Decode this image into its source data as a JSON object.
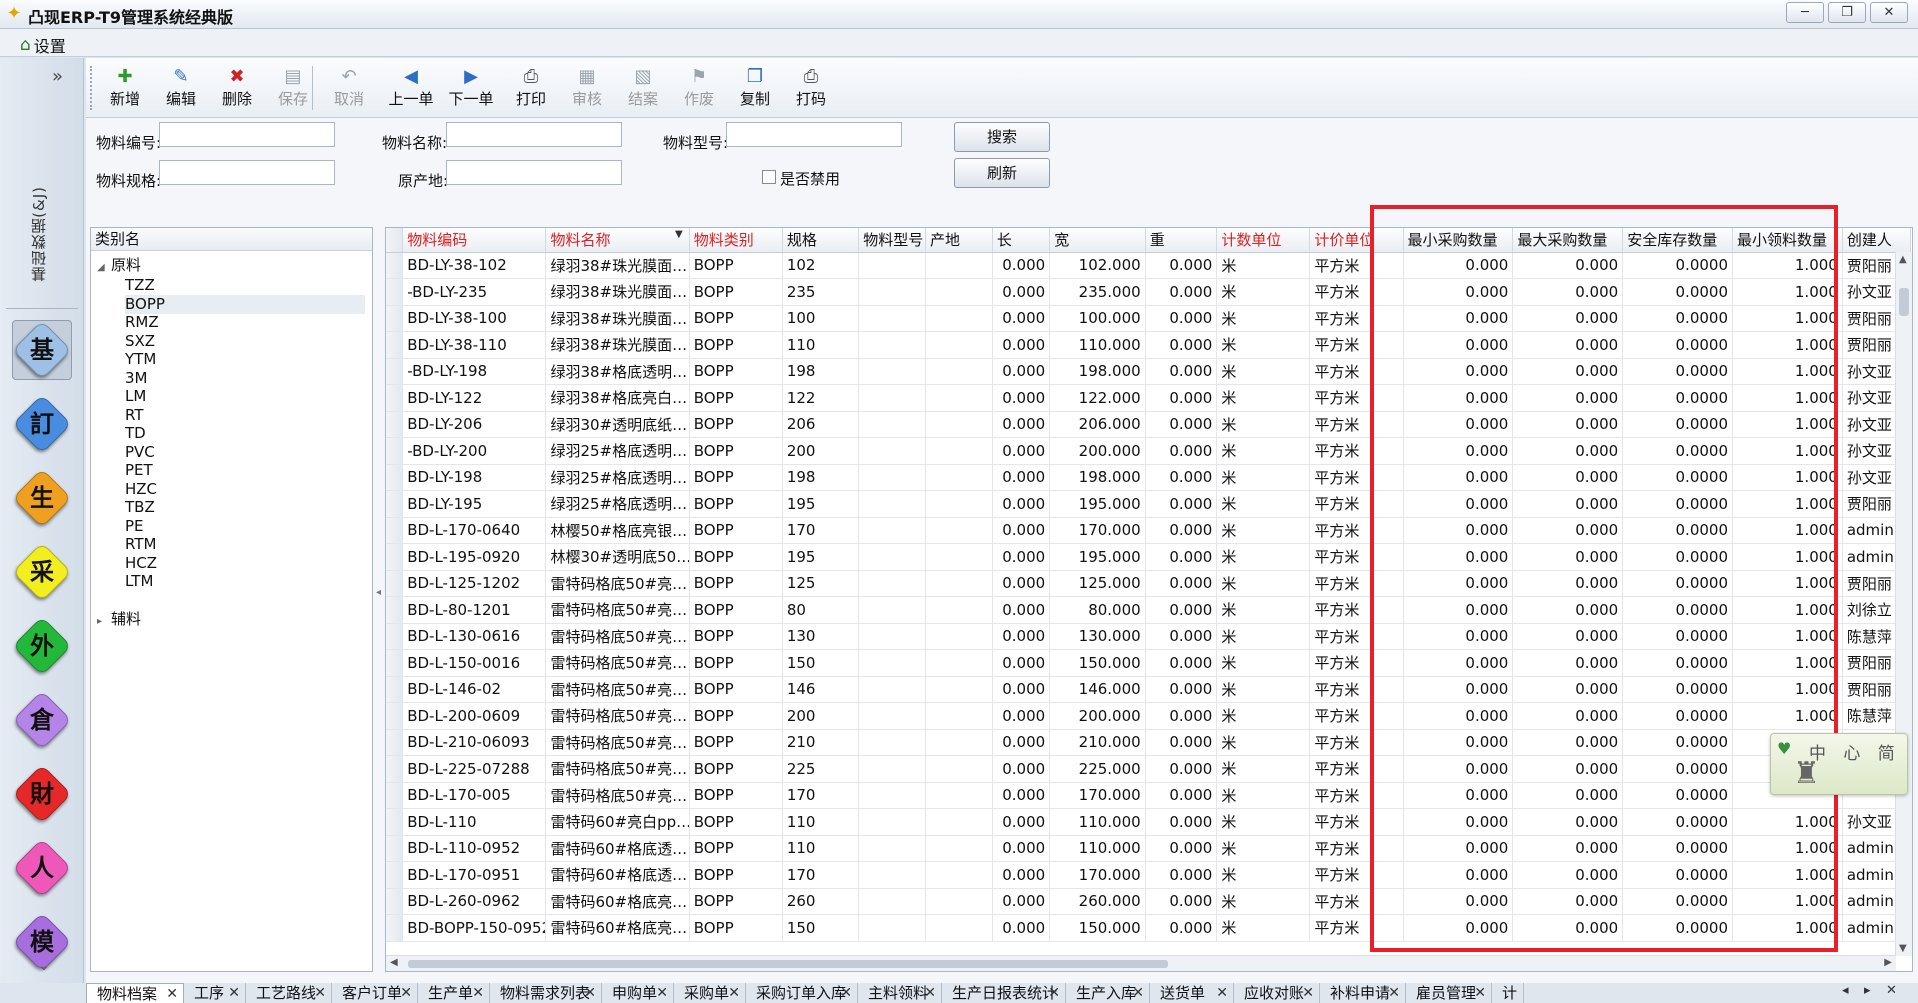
{
  "window": {
    "title": "凸现ERP-T9管理系统经典版",
    "icon": "star-logo-icon",
    "buttons": [
      "─",
      "❐",
      "✕"
    ]
  },
  "menu": {
    "settings": "设置"
  },
  "leftnav": {
    "collapse": "»",
    "section": "基础数据(&J)",
    "buttons": [
      {
        "glyph": "基",
        "color": "#9fc0e6",
        "name": "basic-data"
      },
      {
        "glyph": "訂",
        "color": "#4a8de0",
        "name": "orders"
      },
      {
        "glyph": "生",
        "color": "#f0a020",
        "name": "production"
      },
      {
        "glyph": "采",
        "color": "#f2ee20",
        "name": "purchase"
      },
      {
        "glyph": "外",
        "color": "#24b83a",
        "name": "outsourcing"
      },
      {
        "glyph": "倉",
        "color": "#b484e8",
        "name": "warehouse"
      },
      {
        "glyph": "財",
        "color": "#e62828",
        "name": "finance"
      },
      {
        "glyph": "人",
        "color": "#ee58b8",
        "name": "personnel"
      },
      {
        "glyph": "模",
        "color": "#a86ee0",
        "name": "molds"
      }
    ],
    "down": "⌄"
  },
  "toolbar": {
    "buttons": [
      {
        "label": "新增",
        "icon": "✚",
        "color": "#2e9a2e",
        "enabled": true,
        "name": "add"
      },
      {
        "label": "编辑",
        "icon": "✎",
        "color": "#2e6fc4",
        "enabled": true,
        "name": "edit"
      },
      {
        "label": "删除",
        "icon": "✖",
        "color": "#d42020",
        "enabled": true,
        "name": "delete"
      },
      {
        "label": "保存",
        "icon": "▤",
        "color": "#9aa4ad",
        "enabled": false,
        "name": "save"
      },
      {
        "label": "取消",
        "icon": "↶",
        "color": "#9aa4ad",
        "enabled": false,
        "name": "cancel"
      },
      {
        "label": "上一单",
        "icon": "◀",
        "color": "#2e6fc4",
        "enabled": true,
        "name": "prev"
      },
      {
        "label": "下一单",
        "icon": "▶",
        "color": "#2e6fc4",
        "enabled": true,
        "name": "next"
      },
      {
        "label": "打印",
        "icon": "⎙",
        "color": "#555",
        "enabled": true,
        "name": "print"
      },
      {
        "label": "审核",
        "icon": "▦",
        "color": "#9aa4ad",
        "enabled": false,
        "name": "audit"
      },
      {
        "label": "结案",
        "icon": "▧",
        "color": "#9aa4ad",
        "enabled": false,
        "name": "close-case"
      },
      {
        "label": "作废",
        "icon": "⚑",
        "color": "#9aa4ad",
        "enabled": false,
        "name": "void"
      },
      {
        "label": "复制",
        "icon": "❐",
        "color": "#2e6fc4",
        "enabled": true,
        "name": "copy"
      },
      {
        "label": "打码",
        "icon": "⎙",
        "color": "#555",
        "enabled": true,
        "name": "barcode"
      }
    ]
  },
  "search": {
    "material_code": {
      "label": "物料编号:",
      "value": ""
    },
    "material_name": {
      "label": "物料名称:",
      "value": ""
    },
    "material_model": {
      "label": "物料型号:",
      "value": ""
    },
    "material_spec": {
      "label": "物料规格:",
      "value": ""
    },
    "origin": {
      "label": "原产地:",
      "value": ""
    },
    "disabled": {
      "label": "是否禁用",
      "checked": false
    },
    "search_btn": "搜索",
    "refresh_btn": "刷新"
  },
  "tree": {
    "header": "类别名",
    "root1": "原料",
    "root2": "辅料",
    "selected": "BOPP",
    "children": [
      "TZZ",
      "BOPP",
      "RMZ",
      "SXZ",
      "YTM",
      "3M",
      "LM",
      "RT",
      "TD",
      "PVC",
      "PET",
      "HZC",
      "TBZ",
      "PE",
      "RTM",
      "HCZ",
      "LTM"
    ],
    "collapse_arrow": "◂"
  },
  "grid": {
    "columns": [
      {
        "label": "物料编码",
        "red": true
      },
      {
        "label": "物料名称",
        "red": true,
        "sort": "▼"
      },
      {
        "label": "物料类别",
        "red": true
      },
      {
        "label": "规格"
      },
      {
        "label": "物料型号"
      },
      {
        "label": "产地"
      },
      {
        "label": "长"
      },
      {
        "label": "宽"
      },
      {
        "label": "重"
      },
      {
        "label": "计数单位",
        "red": true
      },
      {
        "label": "计价单位",
        "red": true
      },
      {
        "label": "最小采购数量"
      },
      {
        "label": "最大采购数量"
      },
      {
        "label": "安全库存数量"
      },
      {
        "label": "最小领料数量"
      },
      {
        "label": "创建人"
      }
    ],
    "rows": [
      [
        "BD-LY-38-102",
        "绿羽38#珠光膜面…",
        "BOPP",
        "102",
        "",
        "",
        "0.000",
        "102.000",
        "0.000",
        "米",
        "平方米",
        "0.000",
        "0.000",
        "0.0000",
        "1.000",
        "贾阳丽"
      ],
      [
        "-BD-LY-235",
        "绿羽38#珠光膜面…",
        "BOPP",
        "235",
        "",
        "",
        "0.000",
        "235.000",
        "0.000",
        "米",
        "平方米",
        "0.000",
        "0.000",
        "0.0000",
        "1.000",
        "孙文亚"
      ],
      [
        "BD-LY-38-100",
        "绿羽38#珠光膜面…",
        "BOPP",
        "100",
        "",
        "",
        "0.000",
        "100.000",
        "0.000",
        "米",
        "平方米",
        "0.000",
        "0.000",
        "0.0000",
        "1.000",
        "贾阳丽"
      ],
      [
        "BD-LY-38-110",
        "绿羽38#珠光膜面…",
        "BOPP",
        "110",
        "",
        "",
        "0.000",
        "110.000",
        "0.000",
        "米",
        "平方米",
        "0.000",
        "0.000",
        "0.0000",
        "1.000",
        "贾阳丽"
      ],
      [
        "-BD-LY-198",
        "绿羽38#格底透明…",
        "BOPP",
        "198",
        "",
        "",
        "0.000",
        "198.000",
        "0.000",
        "米",
        "平方米",
        "0.000",
        "0.000",
        "0.0000",
        "1.000",
        "孙文亚"
      ],
      [
        "BD-LY-122",
        "绿羽38#格底亮白…",
        "BOPP",
        "122",
        "",
        "",
        "0.000",
        "122.000",
        "0.000",
        "米",
        "平方米",
        "0.000",
        "0.000",
        "0.0000",
        "1.000",
        "孙文亚"
      ],
      [
        "BD-LY-206",
        "绿羽30#透明底纸…",
        "BOPP",
        "206",
        "",
        "",
        "0.000",
        "206.000",
        "0.000",
        "米",
        "平方米",
        "0.000",
        "0.000",
        "0.0000",
        "1.000",
        "孙文亚"
      ],
      [
        "-BD-LY-200",
        "绿羽25#格底透明…",
        "BOPP",
        "200",
        "",
        "",
        "0.000",
        "200.000",
        "0.000",
        "米",
        "平方米",
        "0.000",
        "0.000",
        "0.0000",
        "1.000",
        "孙文亚"
      ],
      [
        "BD-LY-198",
        "绿羽25#格底透明…",
        "BOPP",
        "198",
        "",
        "",
        "0.000",
        "198.000",
        "0.000",
        "米",
        "平方米",
        "0.000",
        "0.000",
        "0.0000",
        "1.000",
        "孙文亚"
      ],
      [
        "BD-LY-195",
        "绿羽25#格底透明…",
        "BOPP",
        "195",
        "",
        "",
        "0.000",
        "195.000",
        "0.000",
        "米",
        "平方米",
        "0.000",
        "0.000",
        "0.0000",
        "1.000",
        "贾阳丽"
      ],
      [
        "BD-L-170-0640",
        "林樱50#格底亮银…",
        "BOPP",
        "170",
        "",
        "",
        "0.000",
        "170.000",
        "0.000",
        "米",
        "平方米",
        "0.000",
        "0.000",
        "0.0000",
        "1.000",
        "admin"
      ],
      [
        "BD-L-195-0920",
        "林樱30#透明底50…",
        "BOPP",
        "195",
        "",
        "",
        "0.000",
        "195.000",
        "0.000",
        "米",
        "平方米",
        "0.000",
        "0.000",
        "0.0000",
        "1.000",
        "admin"
      ],
      [
        "BD-L-125-1202",
        "雷特码格底50#亮…",
        "BOPP",
        "125",
        "",
        "",
        "0.000",
        "125.000",
        "0.000",
        "米",
        "平方米",
        "0.000",
        "0.000",
        "0.0000",
        "1.000",
        "贾阳丽"
      ],
      [
        "BD-L-80-1201",
        "雷特码格底50#亮…",
        "BOPP",
        "80",
        "",
        "",
        "0.000",
        "80.000",
        "0.000",
        "米",
        "平方米",
        "0.000",
        "0.000",
        "0.0000",
        "1.000",
        "刘徐立"
      ],
      [
        "BD-L-130-0616",
        "雷特码格底50#亮…",
        "BOPP",
        "130",
        "",
        "",
        "0.000",
        "130.000",
        "0.000",
        "米",
        "平方米",
        "0.000",
        "0.000",
        "0.0000",
        "1.000",
        "陈慧萍"
      ],
      [
        "BD-L-150-0016",
        "雷特码格底50#亮…",
        "BOPP",
        "150",
        "",
        "",
        "0.000",
        "150.000",
        "0.000",
        "米",
        "平方米",
        "0.000",
        "0.000",
        "0.0000",
        "1.000",
        "贾阳丽"
      ],
      [
        "BD-L-146-02",
        "雷特码格底50#亮…",
        "BOPP",
        "146",
        "",
        "",
        "0.000",
        "146.000",
        "0.000",
        "米",
        "平方米",
        "0.000",
        "0.000",
        "0.0000",
        "1.000",
        "贾阳丽"
      ],
      [
        "BD-L-200-0609",
        "雷特码格底50#亮…",
        "BOPP",
        "200",
        "",
        "",
        "0.000",
        "200.000",
        "0.000",
        "米",
        "平方米",
        "0.000",
        "0.000",
        "0.0000",
        "1.000",
        "陈慧萍"
      ],
      [
        "BD-L-210-06093",
        "雷特码格底50#亮…",
        "BOPP",
        "210",
        "",
        "",
        "0.000",
        "210.000",
        "0.000",
        "米",
        "平方米",
        "0.000",
        "0.000",
        "0.0000",
        "",
        ""
      ],
      [
        "BD-L-225-07288",
        "雷特码格底50#亮…",
        "BOPP",
        "225",
        "",
        "",
        "0.000",
        "225.000",
        "0.000",
        "米",
        "平方米",
        "0.000",
        "0.000",
        "0.0000",
        "",
        ""
      ],
      [
        "BD-L-170-005",
        "雷特码格底50#亮…",
        "BOPP",
        "170",
        "",
        "",
        "0.000",
        "170.000",
        "0.000",
        "米",
        "平方米",
        "0.000",
        "0.000",
        "0.0000",
        "",
        ""
      ],
      [
        "BD-L-110",
        "雷特码60#亮白pp…",
        "BOPP",
        "110",
        "",
        "",
        "0.000",
        "110.000",
        "0.000",
        "米",
        "平方米",
        "0.000",
        "0.000",
        "0.0000",
        "1.000",
        "孙文亚"
      ],
      [
        "BD-L-110-0952",
        "雷特码60#格底透…",
        "BOPP",
        "110",
        "",
        "",
        "0.000",
        "110.000",
        "0.000",
        "米",
        "平方米",
        "0.000",
        "0.000",
        "0.0000",
        "1.000",
        "admin"
      ],
      [
        "BD-L-170-0951",
        "雷特码60#格底透…",
        "BOPP",
        "170",
        "",
        "",
        "0.000",
        "170.000",
        "0.000",
        "米",
        "平方米",
        "0.000",
        "0.000",
        "0.0000",
        "1.000",
        "admin"
      ],
      [
        "BD-L-260-0962",
        "雷特码60#格底亮…",
        "BOPP",
        "260",
        "",
        "",
        "0.000",
        "260.000",
        "0.000",
        "米",
        "平方米",
        "0.000",
        "0.000",
        "0.0000",
        "1.000",
        "admin"
      ],
      [
        "BD-BOPP-150-0952",
        "雷特码60#格底亮…",
        "BOPP",
        "150",
        "",
        "",
        "0.000",
        "150.000",
        "0.000",
        "米",
        "平方米",
        "0.000",
        "0.000",
        "0.0000",
        "1.000",
        "admin"
      ]
    ]
  },
  "widget": {
    "heart": "♥",
    "text": "中 心 简",
    "tower": "♜"
  },
  "tabs": [
    {
      "label": "物料档案",
      "active": true
    },
    {
      "label": "工序"
    },
    {
      "label": "工艺路线"
    },
    {
      "label": "客户订单"
    },
    {
      "label": "生产单"
    },
    {
      "label": "物料需求列表"
    },
    {
      "label": "申购单"
    },
    {
      "label": "采购单"
    },
    {
      "label": "采购订单入库"
    },
    {
      "label": "主料领料"
    },
    {
      "label": "生产日报表统计"
    },
    {
      "label": "生产入库"
    },
    {
      "label": "送货单"
    },
    {
      "label": "应收对账"
    },
    {
      "label": "补料申请"
    },
    {
      "label": "雇员管理"
    },
    {
      "label": "计"
    }
  ],
  "tabnav": [
    "◂",
    "▸",
    "✕"
  ]
}
